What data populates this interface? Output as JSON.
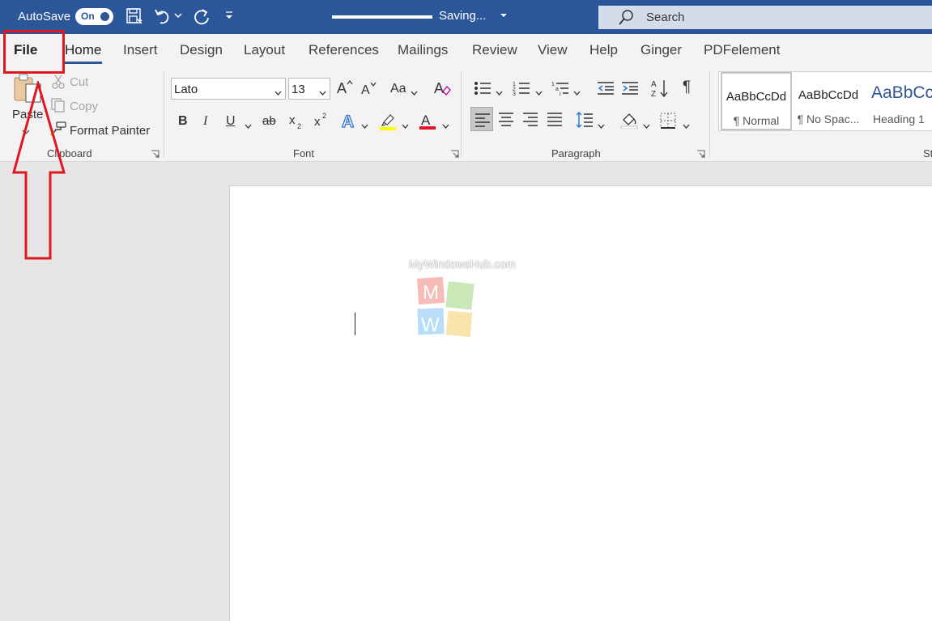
{
  "titlebar": {
    "autosave_label": "AutoSave",
    "autosave_state": "On",
    "saving_status": "Saving...",
    "search_placeholder": "Search",
    "bg_color": "#2b579a"
  },
  "tabs": [
    {
      "label": "File"
    },
    {
      "label": "Home",
      "active": true
    },
    {
      "label": "Insert"
    },
    {
      "label": "Design"
    },
    {
      "label": "Layout"
    },
    {
      "label": "References"
    },
    {
      "label": "Mailings"
    },
    {
      "label": "Review"
    },
    {
      "label": "View"
    },
    {
      "label": "Help"
    },
    {
      "label": "Ginger"
    },
    {
      "label": "PDFelement"
    }
  ],
  "clipboard": {
    "paste_label": "Paste",
    "cut_label": "Cut",
    "copy_label": "Copy",
    "format_painter_label": "Format Painter",
    "group_label": "Clipboard"
  },
  "font": {
    "font_name": "Lato",
    "font_size": "13",
    "change_case_label": "Aa",
    "group_label": "Font"
  },
  "paragraph": {
    "group_label": "Paragraph"
  },
  "styles": {
    "items": [
      {
        "sample": "AaBbCcDd",
        "name": "¶ Normal"
      },
      {
        "sample": "AaBbCcDd",
        "name": "¶ No Spac..."
      },
      {
        "sample": "AaBbCc",
        "name": "Heading 1"
      }
    ],
    "group_label": "St"
  },
  "watermark": {
    "text": "MyWindowsHub.com",
    "letters": [
      "M",
      "W"
    ]
  },
  "annotation": {
    "color": "#e0171f"
  }
}
